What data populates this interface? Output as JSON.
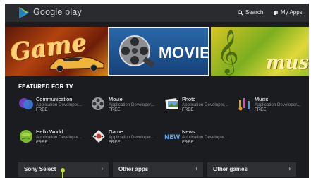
{
  "header": {
    "brand": "Google play",
    "search_label": "Search",
    "apps_label": "My Apps"
  },
  "banner": {
    "tiles": [
      {
        "label": "Game"
      },
      {
        "label": "MOVIE"
      },
      {
        "label": "music"
      }
    ]
  },
  "featured": {
    "title": "FEATURED FOR TV",
    "apps": [
      {
        "name": "Communication",
        "developer": "Application Developer...",
        "price": "FREE",
        "icon": "communication-icon"
      },
      {
        "name": "Movie",
        "developer": "Application Developer...",
        "price": "FREE",
        "icon": "movie-reel-icon"
      },
      {
        "name": "Photo",
        "developer": "Application Developer...",
        "price": "FREE",
        "icon": "photo-icon"
      },
      {
        "name": "Music",
        "developer": "Application Developer...",
        "price": "FREE",
        "icon": "music-note-icon"
      },
      {
        "name": "Hello World",
        "developer": "Application Developer...",
        "price": "FREE",
        "icon": "globe-icon"
      },
      {
        "name": "Game",
        "developer": "Application Developer...",
        "price": "FREE",
        "icon": "game-icon"
      },
      {
        "name": "News",
        "developer": "Application Developer...",
        "price": "FREE",
        "icon": "news-icon"
      }
    ]
  },
  "bottom": {
    "items": [
      {
        "label": "Sony Select",
        "chevron": "›"
      },
      {
        "label": "Other apps",
        "chevron": "›"
      },
      {
        "label": "Other games",
        "chevron": "›"
      }
    ]
  },
  "colors": {
    "background": "#1b1c1f",
    "header": "#2a2b2e",
    "accent": "#b9e03a"
  }
}
